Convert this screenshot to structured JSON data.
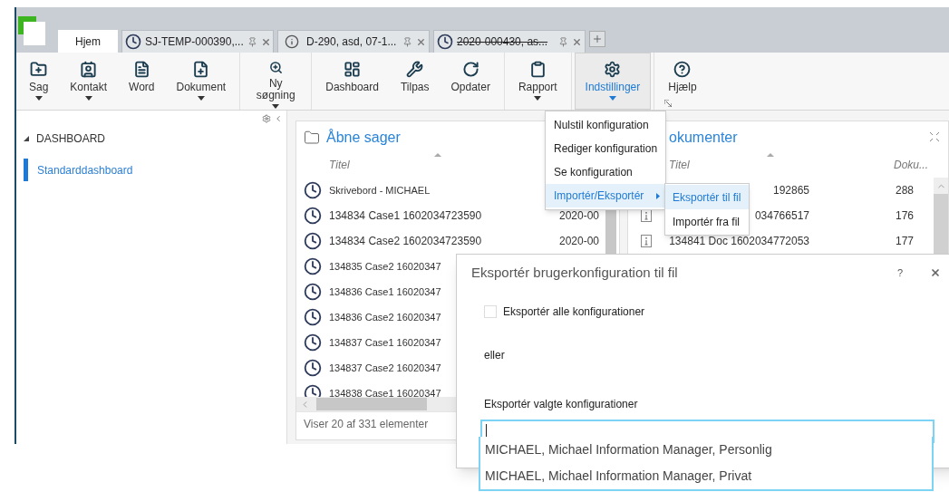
{
  "tabs": [
    {
      "label": "Hjem",
      "kind": "home",
      "strike": false,
      "selected": true
    },
    {
      "label": "SJ-TEMP-000390,...",
      "kind": "case",
      "strike": false,
      "selected": false
    },
    {
      "label": "D-290, asd, 07-1...",
      "kind": "document",
      "strike": false,
      "selected": false
    },
    {
      "label": "2020-000430, as...",
      "kind": "case",
      "strike": true,
      "selected": false
    }
  ],
  "ribbon": {
    "groups": [
      {
        "buttons": [
          {
            "label": "Sag",
            "dropdown": true,
            "selected": false
          },
          {
            "label": "Kontakt",
            "dropdown": true,
            "selected": false
          },
          {
            "label": "Word",
            "dropdown": false,
            "selected": false
          },
          {
            "label": "Dokument",
            "dropdown": true,
            "selected": false
          }
        ]
      },
      {
        "buttons": [
          {
            "label": "Ny søgning",
            "dropdown": true,
            "selected": false
          }
        ]
      },
      {
        "buttons": [
          {
            "label": "Dashboard",
            "dropdown": false,
            "selected": false
          },
          {
            "label": "Tilpas",
            "dropdown": false,
            "selected": false
          },
          {
            "label": "Opdater",
            "dropdown": false,
            "selected": false
          }
        ]
      },
      {
        "buttons": [
          {
            "label": "Rapport",
            "dropdown": true,
            "selected": false
          }
        ]
      },
      {
        "buttons": [
          {
            "label": "Indstillinger",
            "dropdown": true,
            "selected": true
          }
        ]
      },
      {
        "buttons": [
          {
            "label": "Hjælp",
            "dropdown": false,
            "selected": false
          }
        ]
      }
    ]
  },
  "sidebar": {
    "section": {
      "label": "DASHBOARD",
      "expanded": true,
      "items": [
        {
          "label": "Standarddashboard",
          "selected": true
        }
      ]
    }
  },
  "open_cases": {
    "title": "Åbne sager",
    "column_1": "Titel",
    "rows": [
      {
        "title": "Skrivebord - MICHAEL"
      },
      {
        "title": "134834 Case1 1602034723590",
        "column_2": "2020-00"
      },
      {
        "title": "134834 Case2 1602034723590",
        "column_2": "2020-00"
      },
      {
        "title": "134835 Case2 16020347"
      },
      {
        "title": "134836 Case1 16020347"
      },
      {
        "title": "134836 Case2 16020347"
      },
      {
        "title": "134837 Case1 16020347"
      },
      {
        "title": "134837 Case2 16020347"
      },
      {
        "title": "134838 Case1 16020347"
      }
    ],
    "footer": "Viser 20 af 331 elementer"
  },
  "documents": {
    "title": "okumenter",
    "columns": [
      "Titel",
      "Doku..."
    ],
    "rows": [
      {
        "title": "192865",
        "number": "288",
        "kind": "plain"
      },
      {
        "title": "034766517",
        "number": "176",
        "kind": "info"
      },
      {
        "title": "134841 Doc 1602034772053",
        "number": "177",
        "kind": "info"
      }
    ]
  },
  "menu": {
    "items": [
      {
        "label": "Nulstil konfiguration",
        "selected": false,
        "has_submenu": false
      },
      {
        "label": "Rediger konfiguration",
        "selected": false,
        "has_submenu": false
      },
      {
        "label": "Se konfiguration",
        "selected": false,
        "has_submenu": false
      },
      {
        "label": "Importér/Eksportér",
        "selected": true,
        "has_submenu": true
      }
    ],
    "submenu": [
      {
        "label": "Eksportér til fil",
        "selected": true
      },
      {
        "label": "Importér fra fil",
        "selected": false
      }
    ]
  },
  "dialog": {
    "title": "Eksportér brugerkonfiguration til fil",
    "help": "?",
    "checkbox": {
      "label": "Eksportér alle konfigurationer",
      "checked": false
    },
    "or_text": "eller",
    "select_label": "Eksportér valgte konfigurationer",
    "options": [
      "MICHAEL, Michael Information Manager, Personlig",
      "MICHAEL, Michael Information Manager, Privat"
    ]
  }
}
